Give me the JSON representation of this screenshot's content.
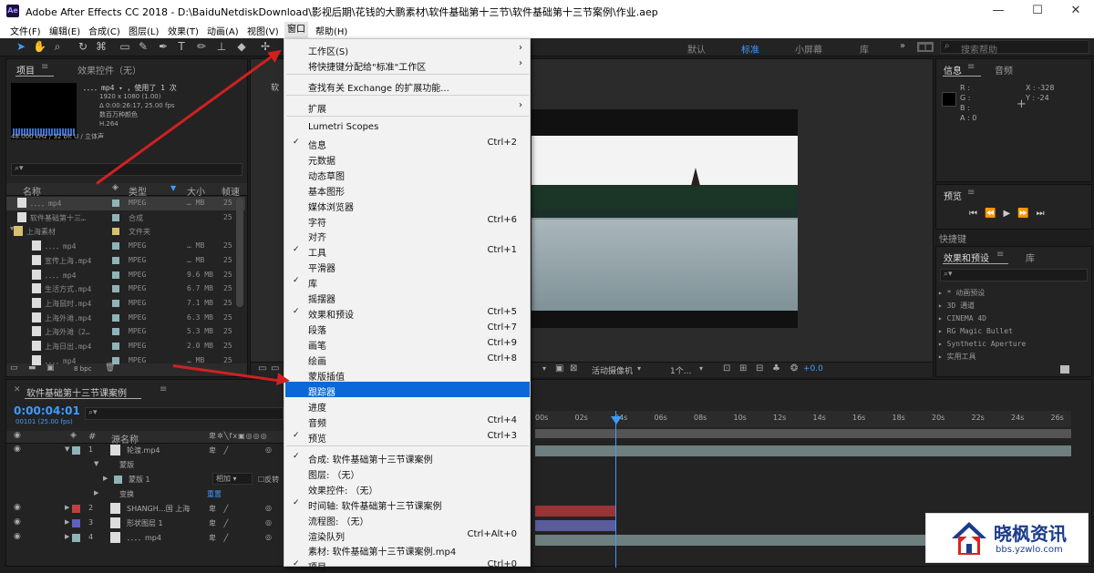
{
  "window": {
    "app_icon": "Ae",
    "title": "Adobe After Effects CC 2018 - D:\\BaiduNetdiskDownload\\影视后期\\花钱的大鹏素材\\软件基础第十三节\\软件基础第十三节案例\\作业.aep",
    "minimize": "—",
    "maximize": "☐",
    "close": "✕"
  },
  "menubar": [
    "文件(F)",
    "编辑(E)",
    "合成(C)",
    "图层(L)",
    "效果(T)",
    "动画(A)",
    "视图(V)",
    "窗口",
    "帮助(H)"
  ],
  "workspaces": [
    "默认",
    "标准",
    "小屏幕",
    "库"
  ],
  "search_help": "搜索帮助",
  "project_panel": {
    "tabs": [
      "项目",
      "效果控件（无）"
    ],
    "selected_file": "．．．．mp4",
    "used": "，使用了 1 次",
    "info_lines": [
      "1920 x 1080 (1.00)",
      "Δ 0:00:26:17, 25.00 fps",
      "数百万种颜色",
      "H.264",
      "48.000 kHz / 32 bit U / 立体声"
    ],
    "columns": [
      "名称",
      "类型",
      "大小",
      "帧速"
    ],
    "items": [
      {
        "name": "．．．．mp4",
        "type": "MPEG",
        "size": "… MB",
        "fps": "25"
      },
      {
        "name": "软件基础第十三…",
        "type": "合成",
        "size": "",
        "fps": "25"
      },
      {
        "name": "上海素材",
        "type": "文件夹",
        "size": "",
        "fps": ""
      },
      {
        "name": "．．．．mp4",
        "type": "MPEG",
        "size": "… MB",
        "fps": "25"
      },
      {
        "name": "宣传上海.mp4",
        "type": "MPEG",
        "size": "… MB",
        "fps": "25"
      },
      {
        "name": "．．．．mp4",
        "type": "MPEG",
        "size": "9.6 MB",
        "fps": "25"
      },
      {
        "name": "生活方式.mp4",
        "type": "MPEG",
        "size": "6.7 MB",
        "fps": "25"
      },
      {
        "name": "上海鼠时.mp4",
        "type": "MPEG",
        "size": "7.1 MB",
        "fps": "25"
      },
      {
        "name": "上海外滩.mp4",
        "type": "MPEG",
        "size": "6.3 MB",
        "fps": "25"
      },
      {
        "name": "上海外滩（2…",
        "type": "MPEG",
        "size": "5.3 MB",
        "fps": "25"
      },
      {
        "name": "上海日出.mp4",
        "type": "MPEG",
        "size": "2.0 MB",
        "fps": "25"
      },
      {
        "name": "．．．．mp4",
        "type": "MPEG",
        "size": "… MB",
        "fps": "25"
      }
    ],
    "bpc": "8 bpc"
  },
  "dropdown": {
    "items": [
      {
        "label": "工作区(S)",
        "shortcut": "",
        "check": false,
        "submenu": true
      },
      {
        "label": "将快捷键分配给\"标准\"工作区",
        "shortcut": "",
        "check": false,
        "submenu": true
      },
      {
        "label": "查找有关 Exchange 的扩展功能...",
        "shortcut": "",
        "check": false,
        "submenu": false
      },
      {
        "label": "扩展",
        "shortcut": "",
        "check": false,
        "submenu": true
      },
      {
        "label": "Lumetri Scopes",
        "shortcut": "",
        "check": false,
        "submenu": false
      },
      {
        "label": "信息",
        "shortcut": "Ctrl+2",
        "check": true,
        "submenu": false
      },
      {
        "label": "元数据",
        "shortcut": "",
        "check": false,
        "submenu": false
      },
      {
        "label": "动态草图",
        "shortcut": "",
        "check": false,
        "submenu": false
      },
      {
        "label": "基本图形",
        "shortcut": "",
        "check": false,
        "submenu": false
      },
      {
        "label": "媒体浏览器",
        "shortcut": "",
        "check": false,
        "submenu": false
      },
      {
        "label": "字符",
        "shortcut": "Ctrl+6",
        "check": false,
        "submenu": false
      },
      {
        "label": "对齐",
        "shortcut": "",
        "check": false,
        "submenu": false
      },
      {
        "label": "工具",
        "shortcut": "Ctrl+1",
        "check": true,
        "submenu": false
      },
      {
        "label": "平滑器",
        "shortcut": "",
        "check": false,
        "submenu": false
      },
      {
        "label": "库",
        "shortcut": "",
        "check": true,
        "submenu": false
      },
      {
        "label": "摇摆器",
        "shortcut": "",
        "check": false,
        "submenu": false
      },
      {
        "label": "效果和预设",
        "shortcut": "Ctrl+5",
        "check": true,
        "submenu": false
      },
      {
        "label": "段落",
        "shortcut": "Ctrl+7",
        "check": false,
        "submenu": false
      },
      {
        "label": "画笔",
        "shortcut": "Ctrl+9",
        "check": false,
        "submenu": false
      },
      {
        "label": "绘画",
        "shortcut": "Ctrl+8",
        "check": false,
        "submenu": false
      },
      {
        "label": "蒙版插值",
        "shortcut": "",
        "check": false,
        "submenu": false
      },
      {
        "label": "跟踪器",
        "shortcut": "",
        "check": false,
        "submenu": false
      },
      {
        "label": "进度",
        "shortcut": "",
        "check": false,
        "submenu": false
      },
      {
        "label": "音频",
        "shortcut": "Ctrl+4",
        "check": false,
        "submenu": false
      },
      {
        "label": "预览",
        "shortcut": "Ctrl+3",
        "check": true,
        "submenu": false
      },
      {
        "label": "合成: 软件基础第十三节课案例",
        "shortcut": "",
        "check": true,
        "submenu": false
      },
      {
        "label": "图层: （无）",
        "shortcut": "",
        "check": false,
        "submenu": false
      },
      {
        "label": "效果控件: （无）",
        "shortcut": "",
        "check": false,
        "submenu": false
      },
      {
        "label": "时间轴: 软件基础第十三节课案例",
        "shortcut": "",
        "check": true,
        "submenu": false
      },
      {
        "label": "流程图: （无）",
        "shortcut": "",
        "check": false,
        "submenu": false
      },
      {
        "label": "渲染队列",
        "shortcut": "Ctrl+Alt+0",
        "check": false,
        "submenu": false
      },
      {
        "label": "素材: 软件基础第十三节课案例.mp4",
        "shortcut": "",
        "check": false,
        "submenu": false
      },
      {
        "label": "项目",
        "shortcut": "Ctrl+0",
        "check": true,
        "submenu": false
      }
    ],
    "highlighted": "跟踪器"
  },
  "viewer": {
    "tab": "软",
    "camera": "活动摄像机",
    "views": "1个...",
    "exposure": "+0.0"
  },
  "info_panel": {
    "tabs": [
      "信息",
      "音频"
    ],
    "rgba": [
      "R :",
      "G :",
      "B :",
      "A : 0"
    ],
    "x": "X : -328",
    "y": "Y : -24"
  },
  "preview_panel": {
    "tab": "预览",
    "shortcut_label": "快捷键"
  },
  "effects_panel": {
    "tabs": [
      "效果和预设",
      "库"
    ],
    "items": [
      "▸ * 动画预设",
      "▸ 3D 通道",
      "▸ CINEMA 4D",
      "▸ RG Magic Bullet",
      "▸ Synthetic Aperture",
      "▸ 实用工具"
    ]
  },
  "timeline": {
    "tab": "软件基础第十三节课案例",
    "timecode": "0:00:04:01",
    "frame": "00101 (25.00 fps)",
    "col_source": "源名称",
    "ruler": [
      "00s",
      "02s",
      "04s",
      "06s",
      "08s",
      "10s",
      "12s",
      "14s",
      "16s",
      "18s",
      "20s",
      "22s",
      "24s",
      "26s"
    ],
    "layers": [
      {
        "num": "1",
        "name": "轮渡.mp4",
        "color": "#8fb4b8"
      },
      {
        "num": "",
        "name": "蒙版",
        "color": ""
      },
      {
        "num": "",
        "name": "蒙版 1",
        "color": "#8fb4b8"
      },
      {
        "num": "",
        "name": "变换",
        "color": ""
      },
      {
        "num": "2",
        "name": "SHANGH…国 上海",
        "color": "#c04040"
      },
      {
        "num": "3",
        "name": "形状图层 1",
        "color": "#6060c0"
      },
      {
        "num": "4",
        "name": "．．．．mp4",
        "color": "#8fb4b8"
      }
    ],
    "mask_mode": "相加",
    "invert": "反转",
    "reset": "重置"
  },
  "watermark": {
    "brand": "晓枫资讯",
    "url": "bbs.yzwlo.com"
  }
}
